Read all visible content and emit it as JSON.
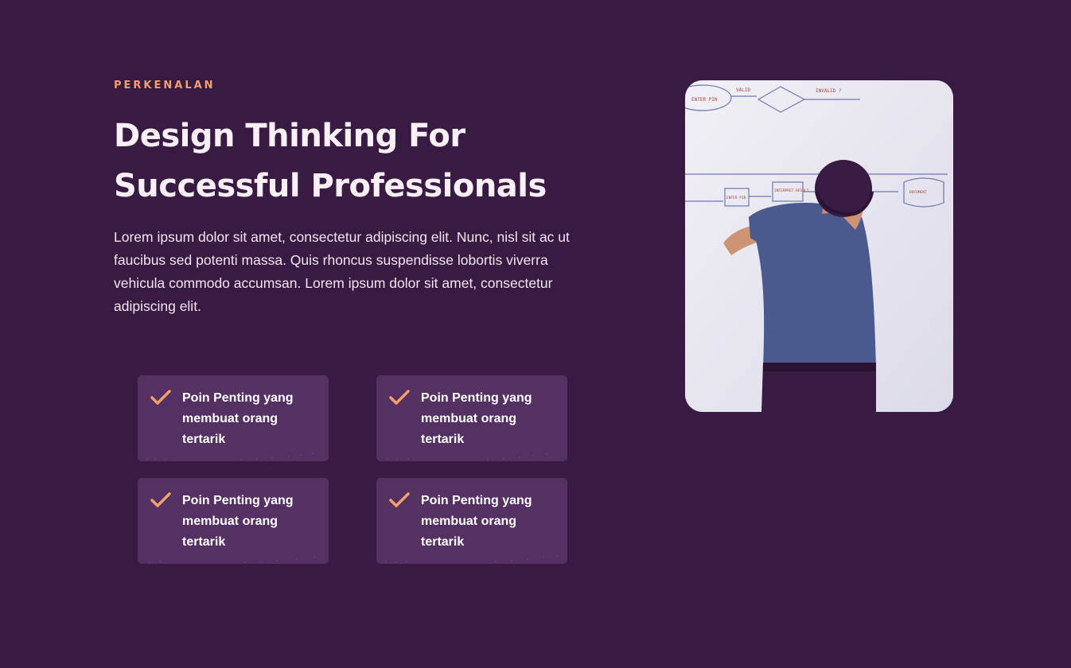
{
  "section": {
    "eyebrow": "PERKENALAN",
    "title_line1": "Design Thinking For",
    "title_line2": "Successful Professionals",
    "description": "Lorem ipsum dolor sit amet, consectetur adipiscing elit. Nunc, nisl sit ac ut faucibus sed potenti massa. Quis rhoncus suspendisse lobortis viverra vehicula commodo accumsan. Lorem ipsum dolor sit amet, consectetur adipiscing elit."
  },
  "points": [
    {
      "text": "Poin Penting yang membuat orang tertarik",
      "icon": "check-icon"
    },
    {
      "text": "Poin Penting yang membuat orang tertarik",
      "icon": "check-icon"
    },
    {
      "text": "Poin Penting yang membuat orang tertarik",
      "icon": "check-icon"
    },
    {
      "text": "Poin Penting yang membuat orang tertarik",
      "icon": "check-icon"
    }
  ],
  "image": {
    "whiteboard_labels": [
      "ENTER PIN",
      "VALID",
      "INVALID ?",
      "ENTER PIN",
      "INTERPRET RESULT",
      "DOCUMENT"
    ]
  },
  "colors": {
    "background": "#381a42",
    "accent": "#f3a06a",
    "card": "#553063",
    "text": "#f8f0f5"
  }
}
